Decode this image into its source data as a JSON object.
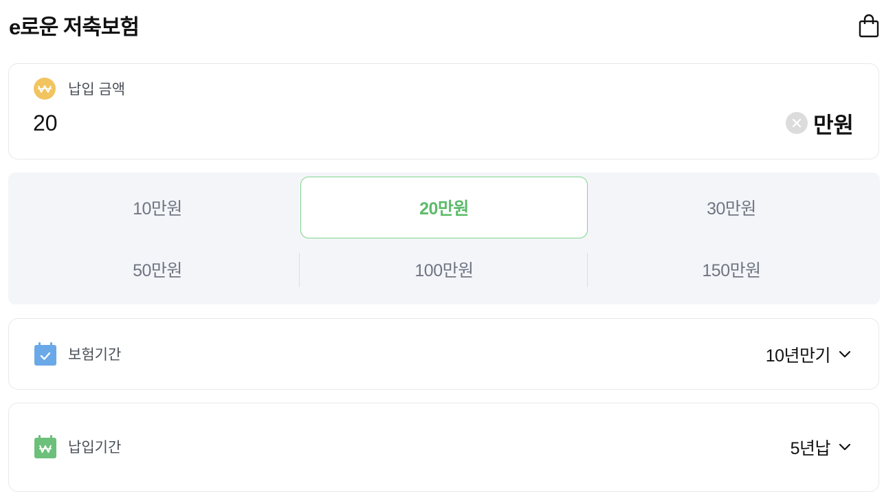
{
  "header": {
    "title": "e로운 저축보험",
    "cart_icon": "shopping-bag-icon"
  },
  "amount": {
    "label": "납입 금액",
    "icon": "won-icon",
    "value": "20",
    "unit": "만원",
    "clear_icon": "clear-icon"
  },
  "quick_amounts": {
    "options": [
      "10만원",
      "20만원",
      "30만원",
      "50만원",
      "100만원",
      "150만원"
    ],
    "selected": "20만원"
  },
  "insurance_period": {
    "label": "보험기간",
    "value": "10년만기",
    "icon": "calendar-check-icon"
  },
  "payment_period": {
    "label": "납입기간",
    "value": "5년납",
    "icon": "calendar-won-icon"
  },
  "colors": {
    "accent_green": "#5cbb6a",
    "won_badge": "#f2c460",
    "calendar_blue": "#6aa8e8",
    "calendar_green": "#6cc07a"
  }
}
